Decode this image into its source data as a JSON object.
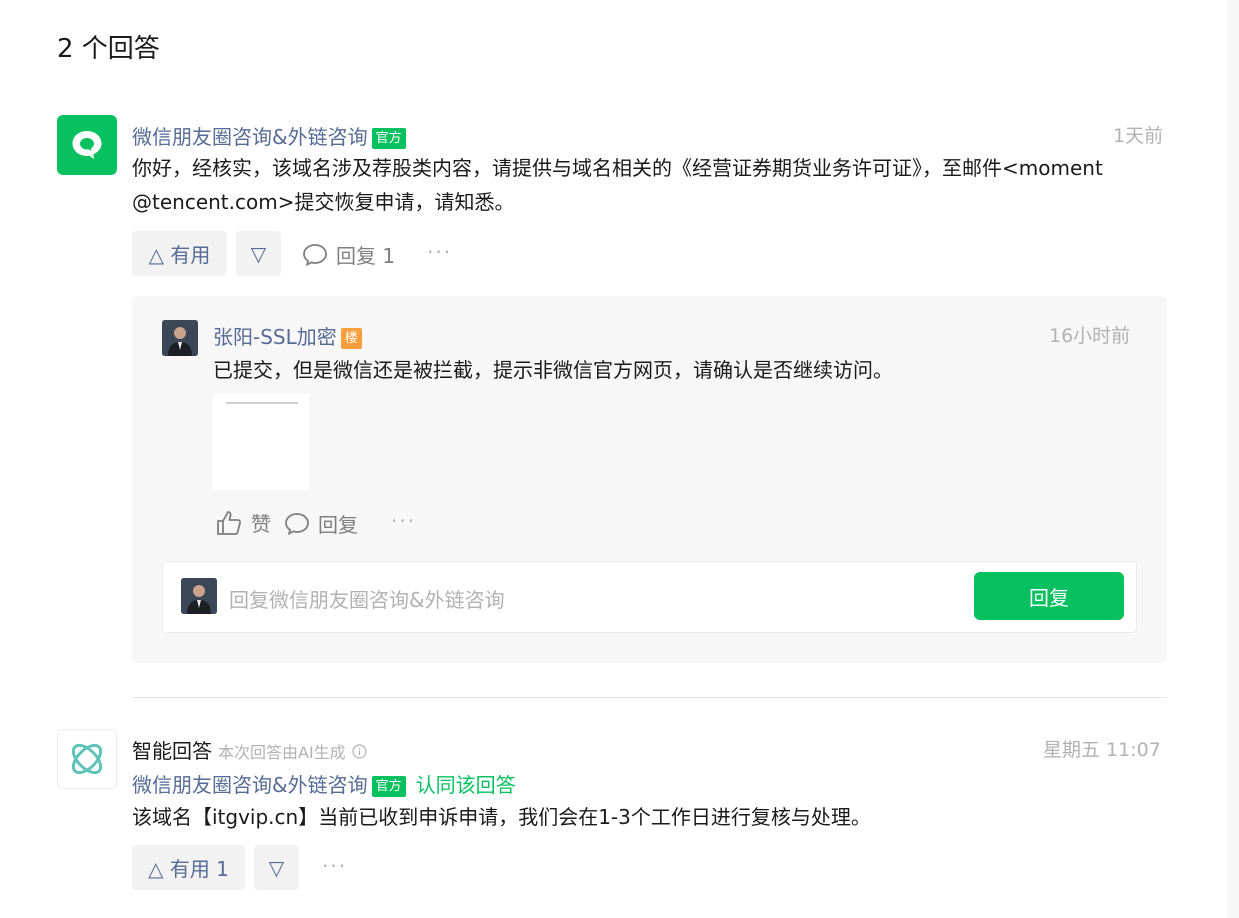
{
  "answers_count": "2 个回答",
  "colors": {
    "brand_green": "#07c160",
    "link_blue": "#576b95",
    "muted": "#b2b2b2",
    "badge_orange": "#fa9d3b"
  },
  "answer1": {
    "author": "微信朋友圈咨询&外链咨询",
    "badge": "官方",
    "time": "1天前",
    "line1": "你好，经核实，该域名涉及荐股类内容，请提供与域名相关的《经营证券期货业务许可证》，至邮件<moment",
    "line2": "@tencent.com>提交恢复申请，请知悉。",
    "useful_label": "△ 有用",
    "down_label": "▽",
    "reply_label": "回复 1",
    "more": "···"
  },
  "comment": {
    "author": "张阳-SSL加密",
    "badge": "楼",
    "time": "16小时前",
    "text": "已提交，但是微信还是被拦截，提示非微信官方网页，请确认是否继续访问。",
    "like_label": "赞",
    "reply_label": "回复",
    "more": "···"
  },
  "reply_input": {
    "placeholder": "回复微信朋友圈咨询&外链咨询",
    "submit_label": "回复"
  },
  "answer2": {
    "title": "智能回答",
    "note": "本次回答由AI生成",
    "time": "星期五 11:07",
    "author": "微信朋友圈咨询&外链咨询",
    "badge": "官方",
    "agree": "认同该回答",
    "text": "该域名【itgvip.cn】当前已收到申诉申请，我们会在1-3个工作日进行复核与处理。",
    "useful_label": "△ 有用 1",
    "down_label": "▽",
    "more": "···"
  },
  "icons": {
    "answer1_avatar": "wechat-bubble-icon",
    "answer2_avatar": "ai-orbit-icon",
    "info": "info-circle-icon",
    "like": "thumbs-up-icon",
    "comment": "speech-bubble-icon"
  }
}
